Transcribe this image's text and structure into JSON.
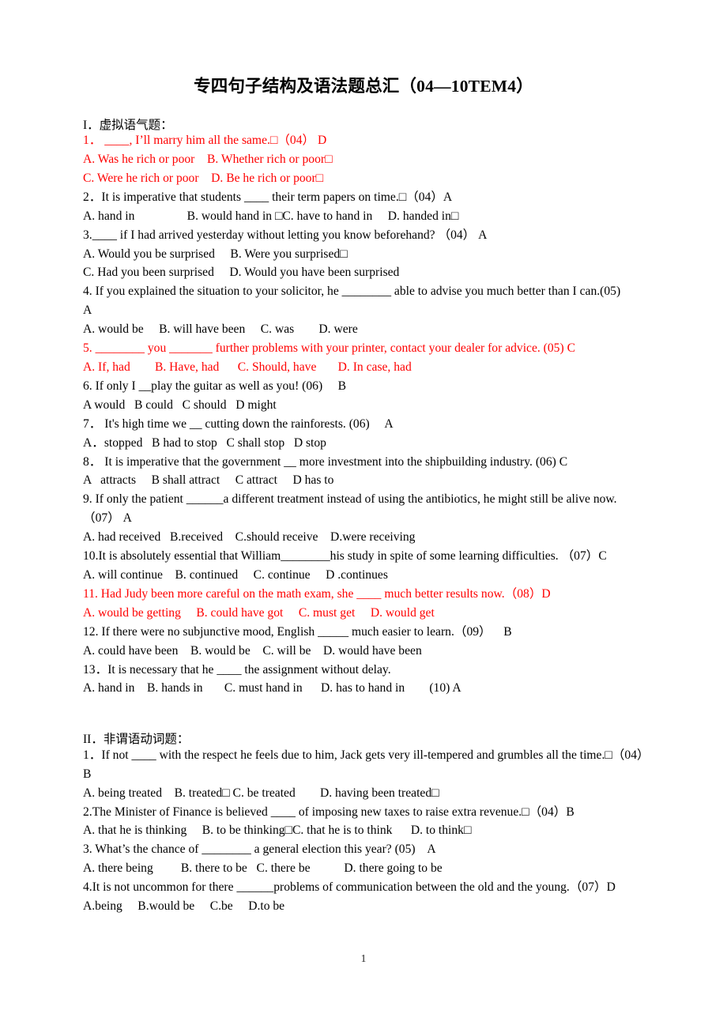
{
  "document": {
    "title": "专四句子结构及语法题总汇（04—10TEM4）",
    "page_number": "1",
    "accent_red": "#FF0000",
    "text_black": "#000000"
  },
  "sections": [
    {
      "heading": "I．虚拟语气题：",
      "lines": [
        {
          "text": "1． ____, I’ll marry him all the same.□（04） D",
          "color": "red"
        },
        {
          "text": "A. Was he rich or poor    B. Whether rich or poor□",
          "color": "red"
        },
        {
          "text": "C. Were he rich or poor    D. Be he rich or poor□",
          "color": "red"
        },
        {
          "text": "2．It is imperative that students ____ their term papers on time.□（04）A",
          "color": "black"
        },
        {
          "text": "A. hand in                 B. would hand in □C. have to hand in     D. handed in□",
          "color": "black"
        },
        {
          "text": "3.____ if I had arrived yesterday without letting you know beforehand? （04） A",
          "color": "black"
        },
        {
          "text": "A. Would you be surprised     B. Were you surprised□",
          "color": "black"
        },
        {
          "text": "C. Had you been surprised     D. Would you have been surprised",
          "color": "black"
        },
        {
          "text": "4. If you explained the situation to your solicitor, he ________ able to advise you much better than I can.(05)      A",
          "color": "black"
        },
        {
          "text": "A. would be     B. will have been     C. was        D. were",
          "color": "black"
        },
        {
          "text": "5. ________ you _______ further problems with your printer, contact your dealer for advice. (05) C",
          "color": "red"
        },
        {
          "text": "A. If, had        B. Have, had      C. Should, have       D. In case, had",
          "color": "red"
        },
        {
          "text": "6. If only I __play the guitar as well as you! (06)     B",
          "color": "black"
        },
        {
          "text": "A would   B could   C should   D might",
          "color": "black"
        },
        {
          "text": "7． It's high time we __ cutting down the rainforests. (06)     A",
          "color": "black"
        },
        {
          "text": "A．stopped   B had to stop   C shall stop   D stop",
          "color": "black"
        },
        {
          "text": "8． It is imperative that the government __ more investment into the shipbuilding industry. (06) C",
          "color": "black"
        },
        {
          "text": "A   attracts     B shall attract     C attract     D has to",
          "color": "black"
        },
        {
          "text": "9. If only the patient ______a different treatment instead of using the antibiotics, he might still be alive now.（07） A",
          "color": "black"
        },
        {
          "text": "A. had received   B.received    C.should receive    D.were receiving",
          "color": "black"
        },
        {
          "text": "10.It is absolutely essential that William________his study in spite of some learning difficulties. （07）C",
          "color": "black"
        },
        {
          "text": "A. will continue    B. continued     C. continue     D .continues",
          "color": "black"
        },
        {
          "text": "11. Had Judy been more careful on the math exam, she ____ much better results now.（08）D",
          "color": "red"
        },
        {
          "text": "A. would be getting     B. could have got     C. must get     D. would get",
          "color": "red"
        },
        {
          "text": "12. If there were no subjunctive mood, English _____ much easier to learn.（09）    B",
          "color": "black"
        },
        {
          "text": "A. could have been    B. would be    C. will be    D. would have been",
          "color": "black"
        },
        {
          "text": "13．It is necessary that he ____ the assignment without delay.",
          "color": "black"
        },
        {
          "text": "A. hand in    B. hands in       C. must hand in      D. has to hand in        (10) A",
          "color": "black"
        }
      ]
    },
    {
      "heading": "II．非谓语动词题：",
      "lines": [
        {
          "text": "1．If not ____ with the respect he feels due to him, Jack gets very ill-tempered and grumbles all the time.□（04）B",
          "color": "black"
        },
        {
          "text": "A. being treated    B. treated□ C. be treated        D. having been treated□",
          "color": "black"
        },
        {
          "text": "2.The Minister of Finance is believed ____ of imposing new taxes to raise extra revenue.□（04）B",
          "color": "black"
        },
        {
          "text": "A. that he is thinking     B. to be thinking□C. that he is to think      D. to think□",
          "color": "black"
        },
        {
          "text": "3. What’s the chance of ________ a general election this year? (05)    A",
          "color": "black"
        },
        {
          "text": "A. there being         B. there to be   C. there be           D. there going to be",
          "color": "black"
        },
        {
          "text": "4.It is not uncommon for there ______problems of communication between the old and the young.（07）D",
          "color": "black"
        },
        {
          "text": "A.being     B.would be     C.be     D.to be",
          "color": "black"
        }
      ]
    }
  ]
}
